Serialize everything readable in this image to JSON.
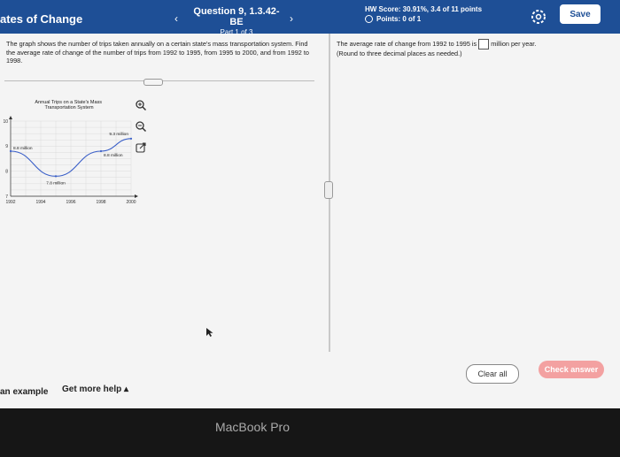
{
  "header": {
    "title": "ates of Change",
    "prev_glyph": "‹",
    "next_glyph": "›",
    "question": "Question 9, 1.3.42-BE",
    "part": "Part 1 of 3",
    "hw_score": "HW Score: 30.91%, 3.4 of 11 points",
    "points": "Points: 0 of 1",
    "save_label": "Save"
  },
  "question": {
    "prompt": "The graph shows the number of trips taken annually on a certain state's mass transportation system. Find the average rate of change of the number of trips from 1992 to 1995, from 1995 to 2000, and from 1992 to 1998."
  },
  "chart_data": {
    "type": "line",
    "title": "Annual Trips on a State's Mass Transportation System",
    "x": [
      1992,
      1995,
      1998,
      2000
    ],
    "y": [
      8.8,
      7.8,
      8.8,
      9.3
    ],
    "point_labels": [
      "8.8 million",
      "7.8 million",
      "8.8 million",
      "9.3 million"
    ],
    "xlim": [
      1992,
      2000
    ],
    "ylim": [
      7,
      10
    ],
    "x_ticks": [
      "1992",
      "1994",
      "1996",
      "1998",
      "2000"
    ],
    "y_ticks": [
      "7",
      "8",
      "9",
      "10"
    ],
    "grid": true,
    "line_color": "#3a5fc8"
  },
  "answer": {
    "line1_pre": "The average rate of change from 1992 to 1995 is",
    "line1_post": "million per year.",
    "line2": "(Round to three decimal places as needed.)"
  },
  "footer": {
    "example": "an example",
    "help": "Get more help ▴",
    "clear_label": "Clear all",
    "check_label": "Check answer",
    "device": "MacBook Pro"
  },
  "colors": {
    "header_bg": "#1e4f96",
    "check_bg": "#f3a1a1"
  }
}
